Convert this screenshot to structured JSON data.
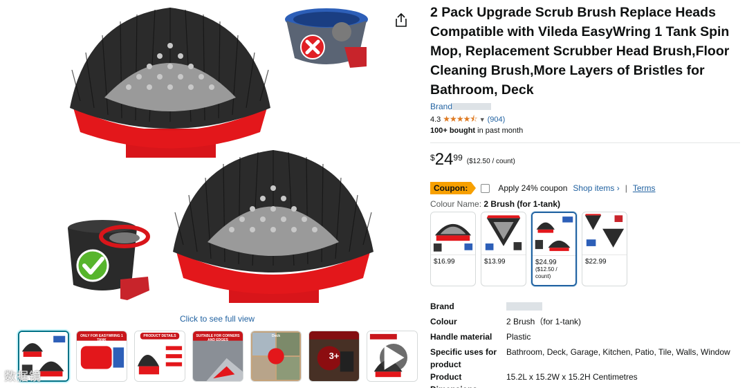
{
  "media": {
    "click_full_view": "Click to see full view",
    "watermark": "数据镜",
    "thumbnails": [
      {
        "caption": ""
      },
      {
        "caption": "ONLY FOR EASYWRING 1 TANK"
      },
      {
        "caption": "PRODUCT DETAILS"
      },
      {
        "caption": "SUITABLE FOR CORNERS AND EDGES"
      },
      {
        "caption": "Deck"
      },
      {
        "caption": "3+"
      },
      {
        "caption": ""
      }
    ]
  },
  "product": {
    "title": "2 Pack Upgrade Scrub Brush Replace Heads Compatible with Vileda EasyWring 1 Tank Spin Mop, Replacement Scrubber Head Brush,Floor Cleaning Brush,More Layers of Bristles for Bathroom, Deck",
    "brand_label": "Brand",
    "rating": "4.3",
    "stars": "★★★★⯪",
    "rating_count": "(904)",
    "bought_bold": "100+ bought",
    "bought_rest": " in past month",
    "price": {
      "symbol": "$",
      "whole": "24",
      "fraction": "99",
      "unit": "($12.50 / count)"
    },
    "coupon": {
      "badge": "Coupon:",
      "text": "Apply 24% coupon",
      "shop_items": "Shop items ›",
      "separator": "|",
      "terms": "Terms"
    },
    "colour_label": "Colour Name:",
    "colour_value": "2 Brush  (for 1-tank)",
    "swatches": [
      {
        "price": "$16.99",
        "unit": ""
      },
      {
        "price": "$13.99",
        "unit": ""
      },
      {
        "price": "$24.99",
        "unit": "($12.50 / count)"
      },
      {
        "price": "$22.99",
        "unit": ""
      }
    ],
    "specs": [
      {
        "key": "Brand",
        "value": ""
      },
      {
        "key": "Colour",
        "value": "2 Brush（for 1-tank)"
      },
      {
        "key": "Handle material",
        "value": "Plastic"
      },
      {
        "key": "Specific uses for product",
        "value": "Bathroom, Deck, Garage, Kitchen, Patio, Tile, Walls, Window"
      },
      {
        "key": "Product Dimensions",
        "value": "15.2L x 15.2W x 15.2H Centimetres"
      }
    ]
  },
  "colors": {
    "link": "#2162a1",
    "coupon": "#f7a000",
    "star": "#de7921",
    "brush_red": "#e3171b",
    "bristle_dark": "#2b2b2b",
    "bristle_grey": "#9a9a9a"
  }
}
